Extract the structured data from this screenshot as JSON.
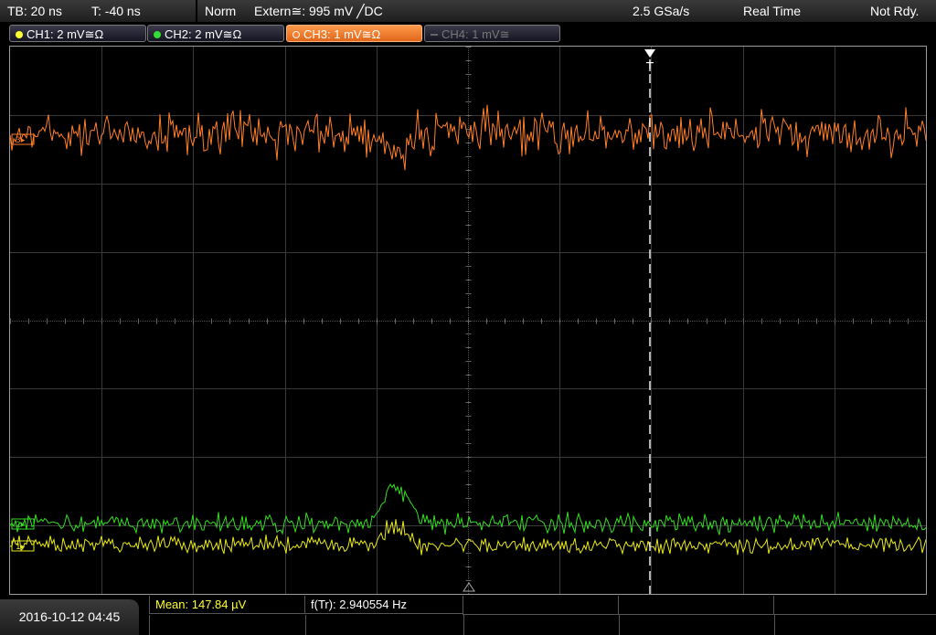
{
  "header": {
    "timebase": "TB: 20 ns",
    "trigger_offset": "T: -40 ns",
    "trigger_mode": "Norm",
    "trigger_source": "Extern≅: 995 mV ╱DC",
    "sample_rate": "2.5 GSa/s",
    "acq_mode": "Real Time",
    "status": "Not Rdy."
  },
  "channels": [
    {
      "label": "CH1: 2 mV≅Ω",
      "color": "#ffff33",
      "active": true
    },
    {
      "label": "CH2: 2 mV≅Ω",
      "color": "#33dd33",
      "active": true
    },
    {
      "label": "CH3: 1 mV≅Ω",
      "color": "#ff7f2a",
      "active": true,
      "selected": true
    },
    {
      "label": "CH4: 1 mV≅",
      "color": "#777777",
      "active": false
    }
  ],
  "markers": {
    "ch3": "3▸",
    "ch2": "2▸",
    "ch1": "1▸",
    "trigger": "T"
  },
  "measurements": {
    "mean": "Mean: 147.84 µV",
    "freq": "f(Tr): 2.940554 Hz"
  },
  "footer": {
    "datetime": "2016-10-12 04:45"
  }
}
